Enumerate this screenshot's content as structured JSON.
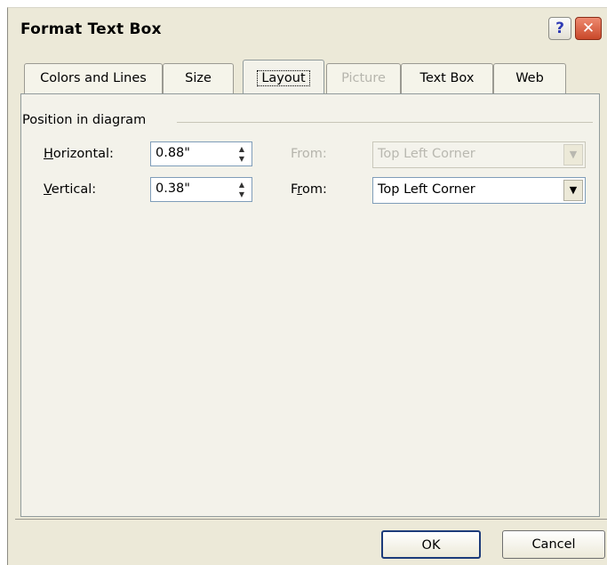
{
  "window": {
    "title": "Format Text Box",
    "help_label": "?",
    "close_label": "✕"
  },
  "tabs": [
    {
      "label": "Colors and Lines",
      "state": "normal"
    },
    {
      "label": "Size",
      "state": "normal"
    },
    {
      "label": "Layout",
      "state": "active"
    },
    {
      "label": "Picture",
      "state": "disabled"
    },
    {
      "label": "Text Box",
      "state": "normal"
    },
    {
      "label": "Web",
      "state": "normal"
    }
  ],
  "position_group": {
    "title": "Position in diagram",
    "horizontal": {
      "label_mnemonic": "H",
      "label_rest": "orizontal:",
      "value": "0.88\"",
      "from_label": "From:",
      "from_value": "Top Left Corner",
      "from_enabled": false
    },
    "vertical": {
      "label_mnemonic": "V",
      "label_rest": "ertical:",
      "value": "0.38\"",
      "from_label_pre": "F",
      "from_label_mnemonic": "r",
      "from_label_post": "om:",
      "from_value": "Top Left Corner",
      "from_enabled": true
    }
  },
  "buttons": {
    "ok": "OK",
    "cancel": "Cancel"
  },
  "icons": {
    "spin_up": "▲",
    "spin_down": "▼",
    "dropdown": "▼"
  }
}
